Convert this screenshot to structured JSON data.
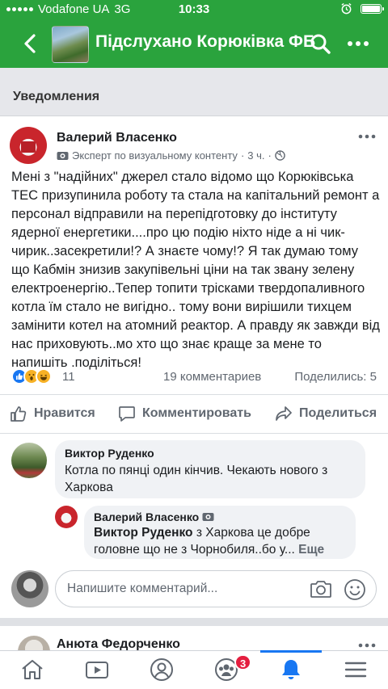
{
  "status_bar": {
    "carrier": "Vodafone UA",
    "network": "3G",
    "time": "10:33"
  },
  "nav": {
    "title": "Підслухано Корюківка ФБ",
    "icons": [
      "back-arrow-icon",
      "search-icon",
      "more-icon"
    ]
  },
  "notification_header": {
    "label": "Уведомления"
  },
  "post": {
    "author": "Валерий Власенко",
    "badge": "Эксперт по визуальному контенту",
    "time": "3 ч.",
    "text": "Мені з \"надійних\" джерел стало відомо що Корюківська ТЕС призупинила роботу та стала на капітальний ремонт а персонал відправили на перепідготовку до інституту ядерної енергетики....про цю подію ніхто ніде а ні чик-чирик..засекретили!? А знаєте чому!? Я так думаю тому що Кабмін знизив закупівельні ціни на так звану зелену електроенергію..Тепер топити трісками твердопаливного котла їм стало не вигідно.. тому вони вирішили тихцем замінити котел на атомний реактор. А правду як завжди від нас приховують..мо хто що знає краще за мене то напишіть .поділіться!",
    "reactions_count": "11",
    "comments_count": "19 комментариев",
    "shares_count": "Поделились: 5",
    "reaction_icons": [
      "like",
      "wow",
      "haha"
    ]
  },
  "actions": {
    "like": "Нравится",
    "comment": "Комментировать",
    "share": "Поделиться"
  },
  "comments": [
    {
      "author": "Виктор Руденко",
      "text": "Котла по пянці один кінчив. Чекають нового з Харкова"
    }
  ],
  "reply": {
    "author": "Валерий Власенко",
    "mention": "Виктор Руденко",
    "text": " з Харкова це добре головне що не з Чорнобиля..бо у...",
    "more": "Еще"
  },
  "comment_input": {
    "placeholder": "Напишите комментарий..."
  },
  "next_post": {
    "author": "Анюта Федорченко"
  },
  "tab_bar": {
    "tabs": [
      "home",
      "watch",
      "profile",
      "groups",
      "notifications",
      "menu"
    ],
    "active": "notifications",
    "groups_badge": "3"
  },
  "colors": {
    "brand_green": "#2aa33d",
    "fb_blue": "#1877f2",
    "badge_red": "#e41e3f"
  }
}
